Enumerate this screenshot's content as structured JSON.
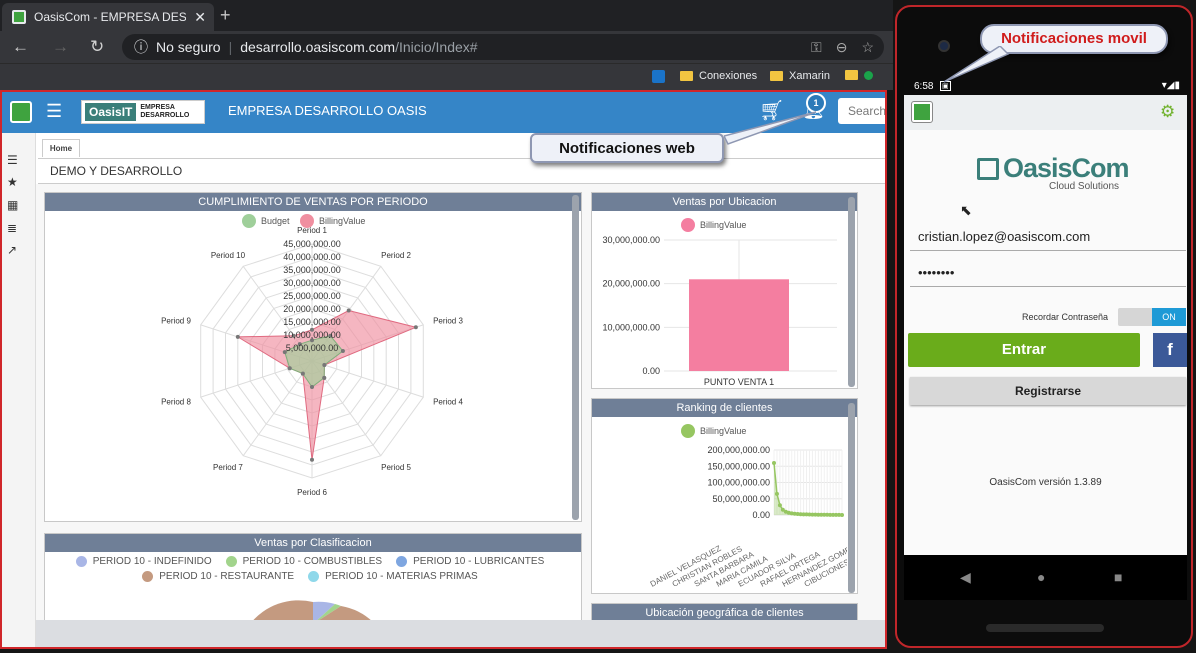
{
  "browser": {
    "tab_title": "OasisCom - EMPRESA DESARROLLO",
    "tab_close": "✕",
    "new_tab": "+",
    "security": "No seguro",
    "url_host": "desarrollo.oasiscom.com",
    "url_path": "/Inicio/Index#",
    "bookmarks": [
      "Conexiones",
      "Xamarin"
    ]
  },
  "app": {
    "brand_logo": "OasisIT",
    "brand_sub1": "EMPRESA",
    "brand_sub2": "DESARROLLO",
    "company": "EMPRESA DESARROLLO OASIS",
    "notification_count": "1",
    "search_placeholder": "Search",
    "home_tab": "Home",
    "breadcrumb": "DEMO Y DESARROLLO",
    "rail_icons": [
      "list-icon",
      "star-icon",
      "calendar-icon",
      "table-icon",
      "trend-icon"
    ]
  },
  "callouts": {
    "web": "Notificaciones web",
    "mobile": "Notificaciones movil"
  },
  "panels": {
    "radar_title": "CUMPLIMIENTO DE VENTAS POR PERIODO",
    "location_title": "Ventas por Ubicacion",
    "ranking_title": "Ranking de clientes",
    "classification_title": "Ventas por Clasificacion",
    "geo_title": "Ubicación geográfica de clientes"
  },
  "chart_data": [
    {
      "type": "radar",
      "title": "CUMPLIMIENTO DE VENTAS POR PERIODO",
      "categories": [
        "Period 1",
        "Period 2",
        "Period 3",
        "Period 4",
        "Period 5",
        "Period 6",
        "Period 7",
        "Period 8",
        "Period 9",
        "Period 10"
      ],
      "series": [
        {
          "name": "Budget",
          "color": "#9fcf9a",
          "values": [
            8000000,
            12000000,
            12500000,
            5000000,
            8000000,
            10000000,
            6000000,
            9000000,
            11000000,
            8000000
          ]
        },
        {
          "name": "BillingValue",
          "color": "#f08fa0",
          "values": [
            12000000,
            24000000,
            42000000,
            5000000,
            8000000,
            38000000,
            6000000,
            9000000,
            30000000,
            12000000
          ]
        }
      ],
      "ticks": [
        "45,000,000.00",
        "40,000,000.00",
        "35,000,000.00",
        "30,000,000.00",
        "25,000,000.00",
        "20,000,000.00",
        "15,000,000.00",
        "10,000,000.00",
        "5,000,000.00"
      ],
      "rmax": 45000000
    },
    {
      "type": "bar",
      "title": "Ventas por Ubicacion",
      "categories": [
        "PUNTO VENTA 1"
      ],
      "series": [
        {
          "name": "BillingValue",
          "color": "#f47ea0",
          "values": [
            21000000
          ]
        }
      ],
      "ylim": [
        0,
        30000000
      ],
      "ticks": [
        "30,000,000.00",
        "20,000,000.00",
        "10,000,000.00",
        "0.00"
      ]
    },
    {
      "type": "line",
      "title": "Ranking de clientes",
      "series": [
        {
          "name": "BillingValue",
          "color": "#96c661",
          "values": [
            160000000,
            65000000,
            30000000,
            16000000,
            10000000,
            7000000,
            5000000,
            4000000,
            3000000,
            2500000,
            2000000,
            1800000,
            1500000,
            1200000,
            1000000,
            900000,
            800000,
            700000,
            600000,
            500000,
            400000,
            300000,
            200000,
            100000
          ]
        }
      ],
      "ylim": [
        0,
        200000000
      ],
      "ticks": [
        "200,000,000.00",
        "150,000,000.00",
        "100,000,000.00",
        "50,000,000.00",
        "0.00"
      ],
      "x_labels": [
        "DANIEL VELASQUEZ",
        "CHRISTIAN ROBLES",
        "SANTA BARBARA",
        "MARIA CAMILA",
        "ECUADOR SILVA",
        "RAFAEL ORTEGA",
        "HERNANDEZ GOMEZ",
        "CIBUCIONES HERNANDEZ"
      ]
    },
    {
      "type": "pie",
      "title": "Ventas por Clasificacion",
      "legend": [
        {
          "name": "PERIOD 10 - INDEFINIDO",
          "color": "#a9b6e6"
        },
        {
          "name": "PERIOD 10 - COMBUSTIBLES",
          "color": "#a2d48c"
        },
        {
          "name": "PERIOD 10 - LUBRICANTES",
          "color": "#7ea6e0"
        },
        {
          "name": "PERIOD 10 - RESTAURANTE",
          "color": "#c49a80"
        },
        {
          "name": "PERIOD 10 - MATERIAS PRIMAS",
          "color": "#8fd8ea"
        }
      ]
    }
  ],
  "mobile": {
    "time": "6:58",
    "logo_name": "OasisCom",
    "logo_tagline": "Cloud Solutions",
    "email": "cristian.lopez@oasiscom.com",
    "password": "••••••••",
    "remember_label": "Recordar Contraseña",
    "toggle_state": "ON",
    "login_button": "Entrar",
    "facebook_button": "f",
    "register_button": "Registrarse",
    "version": "OasisCom versión 1.3.89"
  }
}
